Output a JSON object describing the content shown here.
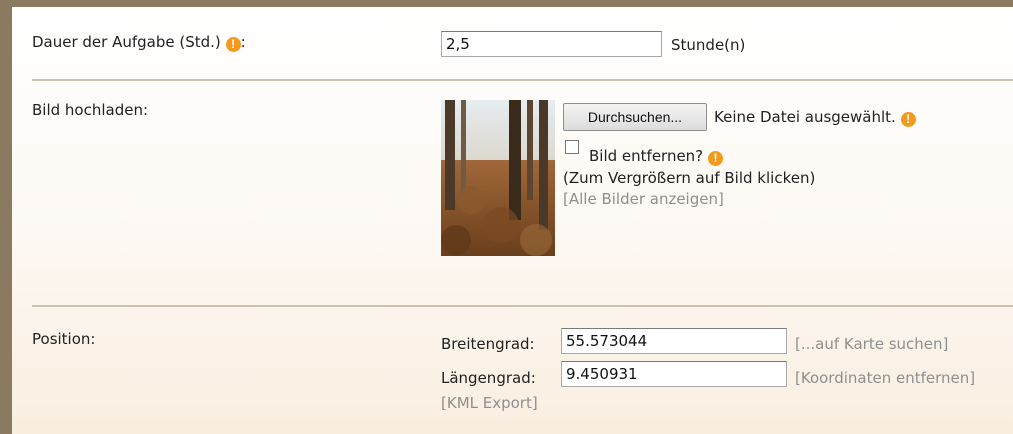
{
  "duration": {
    "label": "Dauer der Aufgabe (Std.)",
    "value": "2,5",
    "unit": "Stunde(n)"
  },
  "image_upload": {
    "label": "Bild hochladen:",
    "browse_label": "Durchsuchen...",
    "no_file_text": "Keine Datei ausgewählt.",
    "remove_label": "Bild entfernen?",
    "enlarge_hint": "(Zum Vergrößern auf Bild klicken)",
    "all_images_link": "[Alle Bilder anzeigen]"
  },
  "position": {
    "label": "Position:",
    "latitude_label": "Breitengrad:",
    "latitude_value": "55.573044",
    "longitude_label": "Längengrad:",
    "longitude_value": "9.450931",
    "find_on_map_link": "[...auf Karte suchen]",
    "remove_coords_link": "[Koordinaten entfernen]",
    "kml_export_link": "[KML Export]"
  },
  "info_icon_glyph": "!",
  "colors": {
    "info_icon": "#f39a1c",
    "link": "#8f8f8f",
    "divider": "#ccc2b0",
    "frame": "#8a7a60"
  }
}
